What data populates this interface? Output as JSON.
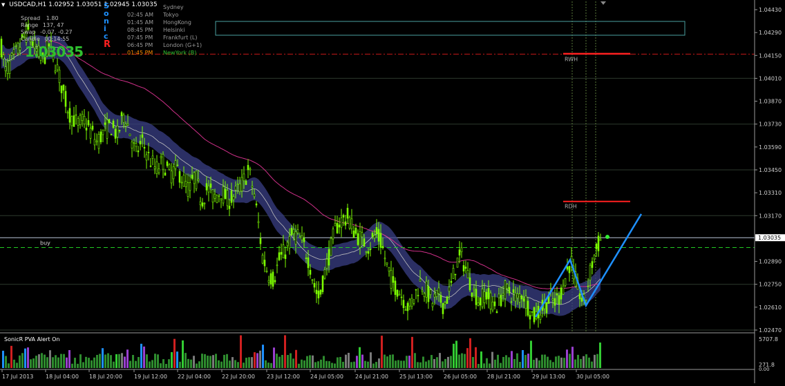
{
  "header": {
    "symbol": "USDCAD,H1",
    "ohlc": "1.02952 1.03051 1.02945 1.03035",
    "ghost_symbol": "USDCAD · H1"
  },
  "info_panel": {
    "spread_label": "Spread",
    "spread_value": "1.80",
    "range_label": "Range",
    "range_value": "137, 47",
    "swap_label": "Swap",
    "swap_value": "-0.07, -0.27",
    "candle_label": "Candle",
    "candle_value": "00:14:55",
    "big_price": "1.03035",
    "sonic_letters": [
      "S",
      "o",
      "n",
      "i",
      "c",
      "R"
    ],
    "sessions": [
      {
        "time": "",
        "name": "Sydney"
      },
      {
        "time": "02:45 AM",
        "name": "Tokyo"
      },
      {
        "time": "01:45 AM",
        "name": "HongKong"
      },
      {
        "time": "08:45 PM",
        "name": "Helsinki"
      },
      {
        "time": "07:45 PM",
        "name": "Frankfurt  (L)"
      },
      {
        "time": "06:45 PM",
        "name": "London  (G+1)"
      },
      {
        "time": "01:45 PM",
        "name": "NewYork  (B)"
      }
    ],
    "colors": {
      "ny_time": "#ff8c00",
      "ny_name": "#2fc02f",
      "sonic_blue": "#1e90ff",
      "sonic_red": "#ff2020"
    }
  },
  "chart_data": {
    "type": "candlestick",
    "symbol": "USDCAD",
    "timeframe": "H1",
    "price_axis": {
      "ticks": [
        "1.04430",
        "1.04290",
        "1.04150",
        "1.04010",
        "1.03870",
        "1.03730",
        "1.03590",
        "1.03450",
        "1.03310",
        "1.03170",
        "1.02890",
        "1.02750",
        "1.02610",
        "1.02470"
      ],
      "current_price": "1.03035",
      "ylim": [
        1.024,
        1.0448
      ]
    },
    "time_axis": [
      "17 Jul 2013",
      "18 Jul 04:00",
      "18 Jul 20:00",
      "19 Jul 12:00",
      "22 Jul 04:00",
      "22 Jul 20:00",
      "23 Jul 12:00",
      "24 Jul 05:00",
      "24 Jul 21:00",
      "25 Jul 13:00",
      "26 Jul 05:00",
      "28 Jul 21:00",
      "29 Jul 13:00",
      "30 Jul 05:00"
    ],
    "price_path": [
      [
        0,
        1.0425
      ],
      [
        8,
        1.0405
      ],
      [
        18,
        1.0412
      ],
      [
        28,
        1.042
      ],
      [
        40,
        1.043
      ],
      [
        52,
        1.0418
      ],
      [
        62,
        1.0412
      ],
      [
        72,
        1.0422
      ],
      [
        82,
        1.0408
      ],
      [
        90,
        1.0395
      ],
      [
        100,
        1.038
      ],
      [
        112,
        1.0373
      ],
      [
        122,
        1.0375
      ],
      [
        132,
        1.0368
      ],
      [
        140,
        1.0362
      ],
      [
        150,
        1.0368
      ],
      [
        160,
        1.0372
      ],
      [
        170,
        1.0366
      ],
      [
        180,
        1.038
      ],
      [
        188,
        1.0368
      ],
      [
        196,
        1.0355
      ],
      [
        206,
        1.0362
      ],
      [
        216,
        1.0352
      ],
      [
        226,
        1.0345
      ],
      [
        236,
        1.035
      ],
      [
        246,
        1.0342
      ],
      [
        256,
        1.0346
      ],
      [
        266,
        1.0338
      ],
      [
        274,
        1.0332
      ],
      [
        282,
        1.0342
      ],
      [
        292,
        1.0326
      ],
      [
        300,
        1.0334
      ],
      [
        310,
        1.0328
      ],
      [
        320,
        1.0332
      ],
      [
        330,
        1.0326
      ],
      [
        340,
        1.033
      ],
      [
        350,
        1.0336
      ],
      [
        360,
        1.0345
      ],
      [
        368,
        1.033
      ],
      [
        374,
        1.0312
      ],
      [
        380,
        1.0292
      ],
      [
        388,
        1.0282
      ],
      [
        396,
        1.0278
      ],
      [
        404,
        1.029
      ],
      [
        414,
        1.0296
      ],
      [
        424,
        1.0306
      ],
      [
        432,
        1.0304
      ],
      [
        440,
        1.0298
      ],
      [
        448,
        1.0288
      ],
      [
        456,
        1.0272
      ],
      [
        462,
        1.0266
      ],
      [
        470,
        1.0282
      ],
      [
        478,
        1.0296
      ],
      [
        486,
        1.031
      ],
      [
        494,
        1.0314
      ],
      [
        504,
        1.0316
      ],
      [
        514,
        1.0306
      ],
      [
        524,
        1.0302
      ],
      [
        534,
        1.0298
      ],
      [
        544,
        1.0306
      ],
      [
        552,
        1.03
      ],
      [
        560,
        1.0286
      ],
      [
        568,
        1.0276
      ],
      [
        576,
        1.0272
      ],
      [
        584,
        1.0266
      ],
      [
        592,
        1.026
      ],
      [
        600,
        1.0268
      ],
      [
        608,
        1.0276
      ],
      [
        616,
        1.0272
      ],
      [
        626,
        1.0264
      ],
      [
        634,
        1.0268
      ],
      [
        642,
        1.0262
      ],
      [
        652,
        1.0272
      ],
      [
        660,
        1.0288
      ],
      [
        668,
        1.0292
      ],
      [
        676,
        1.0282
      ],
      [
        684,
        1.0272
      ],
      [
        694,
        1.0264
      ],
      [
        702,
        1.027
      ],
      [
        712,
        1.0264
      ],
      [
        720,
        1.0262
      ],
      [
        730,
        1.0272
      ],
      [
        738,
        1.027
      ],
      [
        748,
        1.0266
      ],
      [
        756,
        1.027
      ],
      [
        764,
        1.0262
      ],
      [
        772,
        1.0255
      ],
      [
        780,
        1.0258
      ],
      [
        788,
        1.0262
      ],
      [
        796,
        1.0266
      ],
      [
        804,
        1.0264
      ],
      [
        812,
        1.027
      ],
      [
        820,
        1.0282
      ],
      [
        826,
        1.029
      ],
      [
        832,
        1.0278
      ],
      [
        840,
        1.0268
      ],
      [
        846,
        1.0262
      ],
      [
        852,
        1.0278
      ],
      [
        858,
        1.029
      ],
      [
        864,
        1.0298
      ],
      [
        870,
        1.0303
      ]
    ],
    "levels": [
      {
        "label": "RWH",
        "price": 1.04158,
        "color": "#ff2020"
      },
      {
        "label": "RDH",
        "price": 1.03257,
        "color": "#ff2020"
      },
      {
        "label": "buy",
        "price": 1.02975,
        "color": "#22cc22"
      }
    ],
    "zigzag": [
      [
        775,
        1.0255
      ],
      [
        825,
        1.029
      ],
      [
        848,
        1.0262
      ],
      [
        928,
        1.0318
      ]
    ],
    "volume_axis": {
      "max": "5707.8",
      "min": "271.8",
      "zero": "0.00"
    },
    "indicator_label": "SonicR PVA   Alert On"
  }
}
